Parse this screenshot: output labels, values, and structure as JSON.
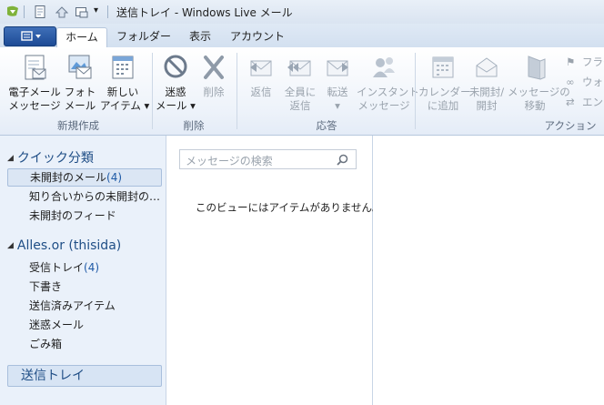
{
  "window": {
    "title": "送信トレイ - Windows Live メール"
  },
  "tabs": [
    {
      "label": "ホーム",
      "active": true
    },
    {
      "label": "フォルダー"
    },
    {
      "label": "表示"
    },
    {
      "label": "アカウント"
    }
  ],
  "ribbon": {
    "new_group": {
      "label": "新規作成",
      "email": "電子メール\nメッセージ",
      "photo": "フォト\nメール",
      "items": "新しい\nアイテム ▾"
    },
    "delete_group": {
      "label": "削除",
      "junk": "迷惑\nメール ▾",
      "delete": "削除"
    },
    "respond_group": {
      "label": "応答",
      "reply": "返信",
      "reply_all": "全員に\n返信",
      "forward": "転送\n▾",
      "im": "インスタント\nメッセージ"
    },
    "actions_group": {
      "label": "アクション",
      "calendar": "カレンダー\nに追加",
      "unread": "未開封/\n開封",
      "move": "メッセージの\n移動",
      "flag": "フラグ",
      "watch": "ウォッ",
      "encode": "エンコ"
    }
  },
  "nav": {
    "quick_views": {
      "title": "クイック分類",
      "items": [
        {
          "label": "未開封のメール",
          "count": "(4)"
        },
        {
          "label": "知り合いからの未開封のメール"
        },
        {
          "label": "未開封のフィード"
        }
      ]
    },
    "account": {
      "title": "Alles.or (thisida)",
      "items": [
        {
          "label": "受信トレイ",
          "count": "(4)"
        },
        {
          "label": "下書き"
        },
        {
          "label": "送信済みアイテム"
        },
        {
          "label": "迷惑メール"
        },
        {
          "label": "ごみ箱"
        }
      ]
    },
    "outbox": "送信トレイ"
  },
  "list": {
    "search_placeholder": "メッセージの検索",
    "empty_text": "このビューにはアイテムがありません。"
  },
  "colors": {
    "accent": "#1f4e86",
    "app_button": "#2a5aa6"
  }
}
